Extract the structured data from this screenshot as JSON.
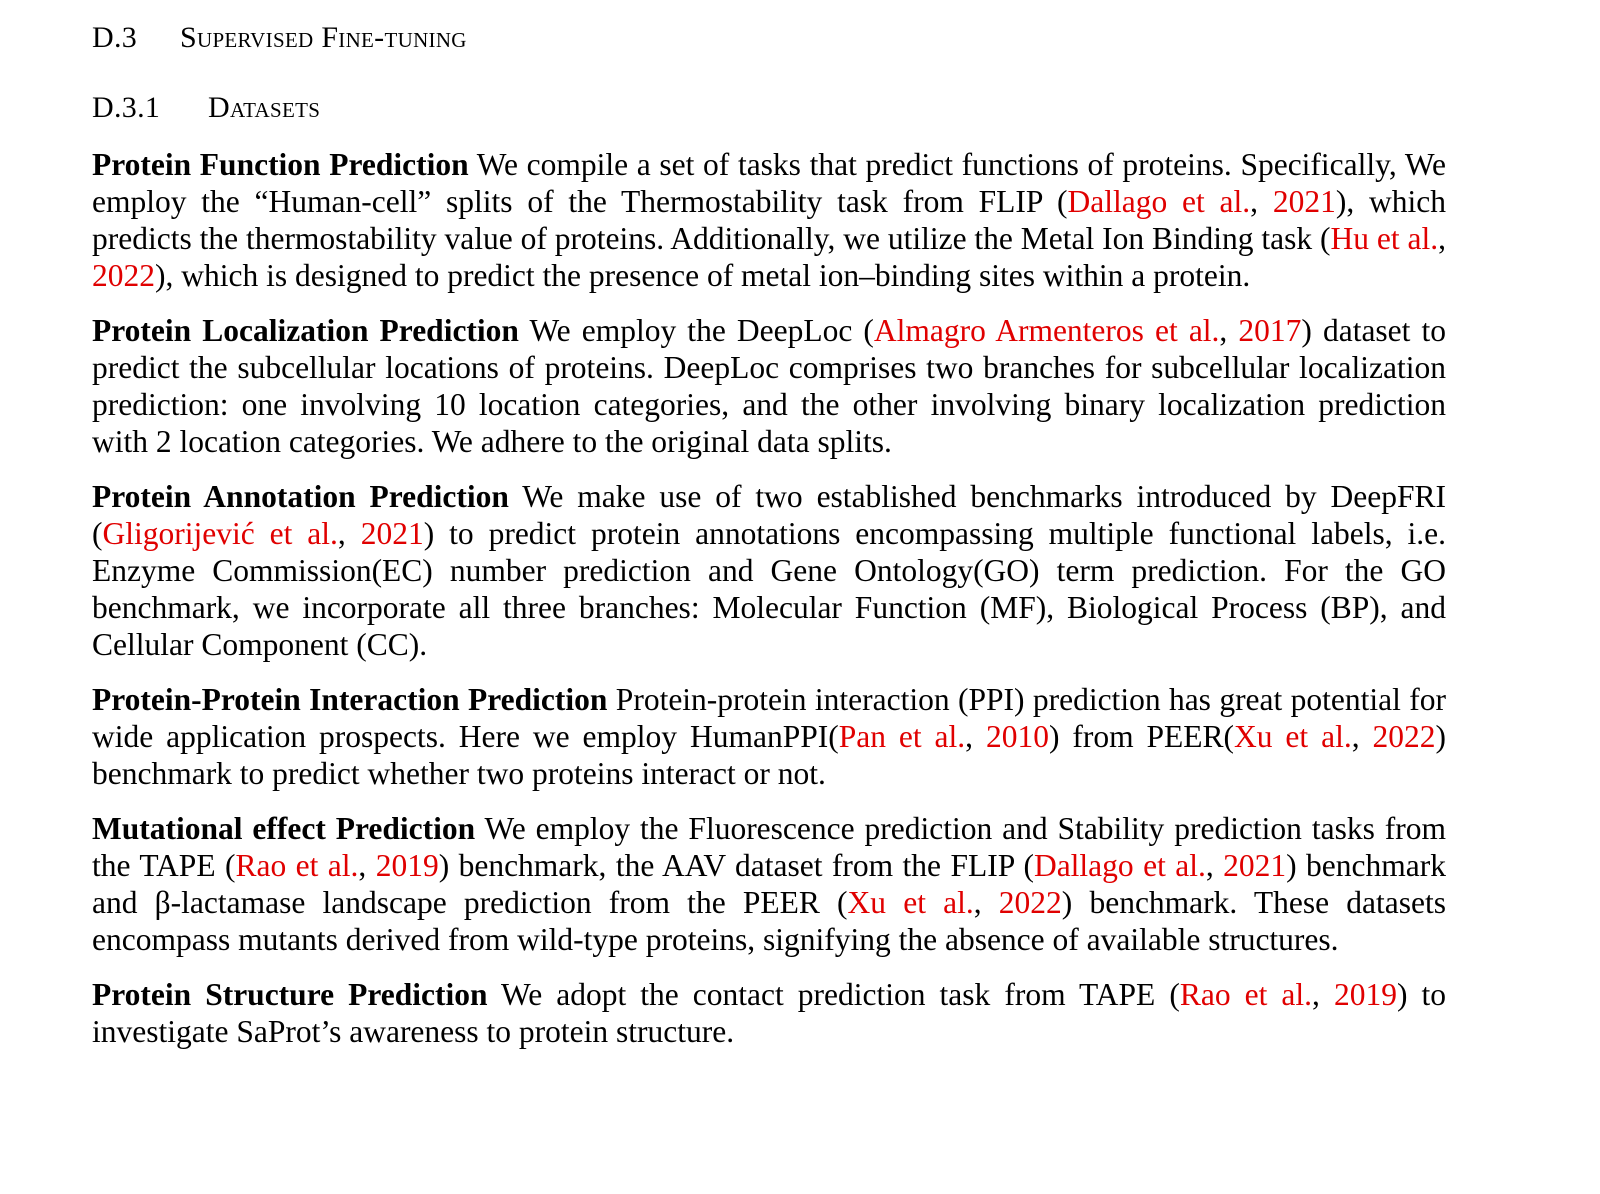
{
  "section": {
    "number": "D.3",
    "title": "Supervised Fine-tuning"
  },
  "subsection": {
    "number": "D.3.1",
    "title": "Datasets"
  },
  "paragraphs": [
    {
      "lead": "Protein Function Prediction",
      "segments": [
        {
          "text": " We compile a set of tasks that predict functions of proteins. Specif­ically, We employ the “Human-cell” splits of the Thermostability task from FLIP ("
        },
        {
          "text": "Dallago et al.",
          "cite": true
        },
        {
          "text": ", "
        },
        {
          "text": "2021",
          "cite": true
        },
        {
          "text": "), which predicts the thermostability value of proteins. Additionally, we utilize the Metal Ion Binding task ("
        },
        {
          "text": "Hu et al.",
          "cite": true
        },
        {
          "text": ", "
        },
        {
          "text": "2022",
          "cite": true
        },
        {
          "text": "), which is designed to predict the presence of metal ion–binding sites within a protein."
        }
      ]
    },
    {
      "lead": "Protein Localization Prediction",
      "segments": [
        {
          "text": " We employ the DeepLoc ("
        },
        {
          "text": "Almagro Armenteros et al.",
          "cite": true
        },
        {
          "text": ", "
        },
        {
          "text": "2017",
          "cite": true
        },
        {
          "text": ") dataset to predict the subcellular locations of proteins. DeepLoc comprises two branches for sub­cellular localization prediction: one involving 10 location categories, and the other involving binary localization prediction with 2 location categories. We adhere to the original data splits."
        }
      ]
    },
    {
      "lead": "Protein Annotation Prediction",
      "segments": [
        {
          "text": " We make use of two established benchmarks introduced by Deep­FRI ("
        },
        {
          "text": "Gligorijević et al.",
          "cite": true
        },
        {
          "text": ", "
        },
        {
          "text": "2021",
          "cite": true
        },
        {
          "text": ") to predict protein annotations encompassing multiple functional la­bels, i.e. Enzyme Commission(EC) number prediction and Gene Ontology(GO) term prediction. For the GO benchmark, we incorporate all three branches: Molecular Function (MF), Biological Process (BP), and Cellular Component (CC)."
        }
      ]
    },
    {
      "lead": "Protein-Protein Interaction Prediction",
      "segments": [
        {
          "text": " Protein-protein interaction (PPI) prediction has great po­tential for wide application prospects. Here we employ HumanPPI("
        },
        {
          "text": "Pan et al.",
          "cite": true
        },
        {
          "text": ", "
        },
        {
          "text": "2010",
          "cite": true
        },
        {
          "text": ") from PEER("
        },
        {
          "text": "Xu et al.",
          "cite": true
        },
        {
          "text": ", "
        },
        {
          "text": "2022",
          "cite": true
        },
        {
          "text": ") benchmark to predict whether two proteins interact or not."
        }
      ]
    },
    {
      "lead": "Mutational effect Prediction",
      "segments": [
        {
          "text": " We employ the Fluorescence prediction and Stability prediction tasks from the TAPE ("
        },
        {
          "text": "Rao et al.",
          "cite": true
        },
        {
          "text": ", "
        },
        {
          "text": "2019",
          "cite": true
        },
        {
          "text": ") benchmark, the AAV dataset from the FLIP ("
        },
        {
          "text": "Dallago et al.",
          "cite": true
        },
        {
          "text": ", "
        },
        {
          "text": "2021",
          "cite": true
        },
        {
          "text": ") benchmark and β-lactamase landscape prediction from the PEER ("
        },
        {
          "text": "Xu et al.",
          "cite": true
        },
        {
          "text": ", "
        },
        {
          "text": "2022",
          "cite": true
        },
        {
          "text": ") bench­mark. These datasets encompass mutants derived from wild-type proteins, signifying the absence of available structures."
        }
      ]
    },
    {
      "lead": "Protein Structure Prediction",
      "segments": [
        {
          "text": " We adopt the contact prediction task from TAPE ("
        },
        {
          "text": "Rao et al.",
          "cite": true
        },
        {
          "text": ", "
        },
        {
          "text": "2019",
          "cite": true
        },
        {
          "text": ") to investigate SaProt’s awareness to protein structure."
        }
      ]
    }
  ]
}
